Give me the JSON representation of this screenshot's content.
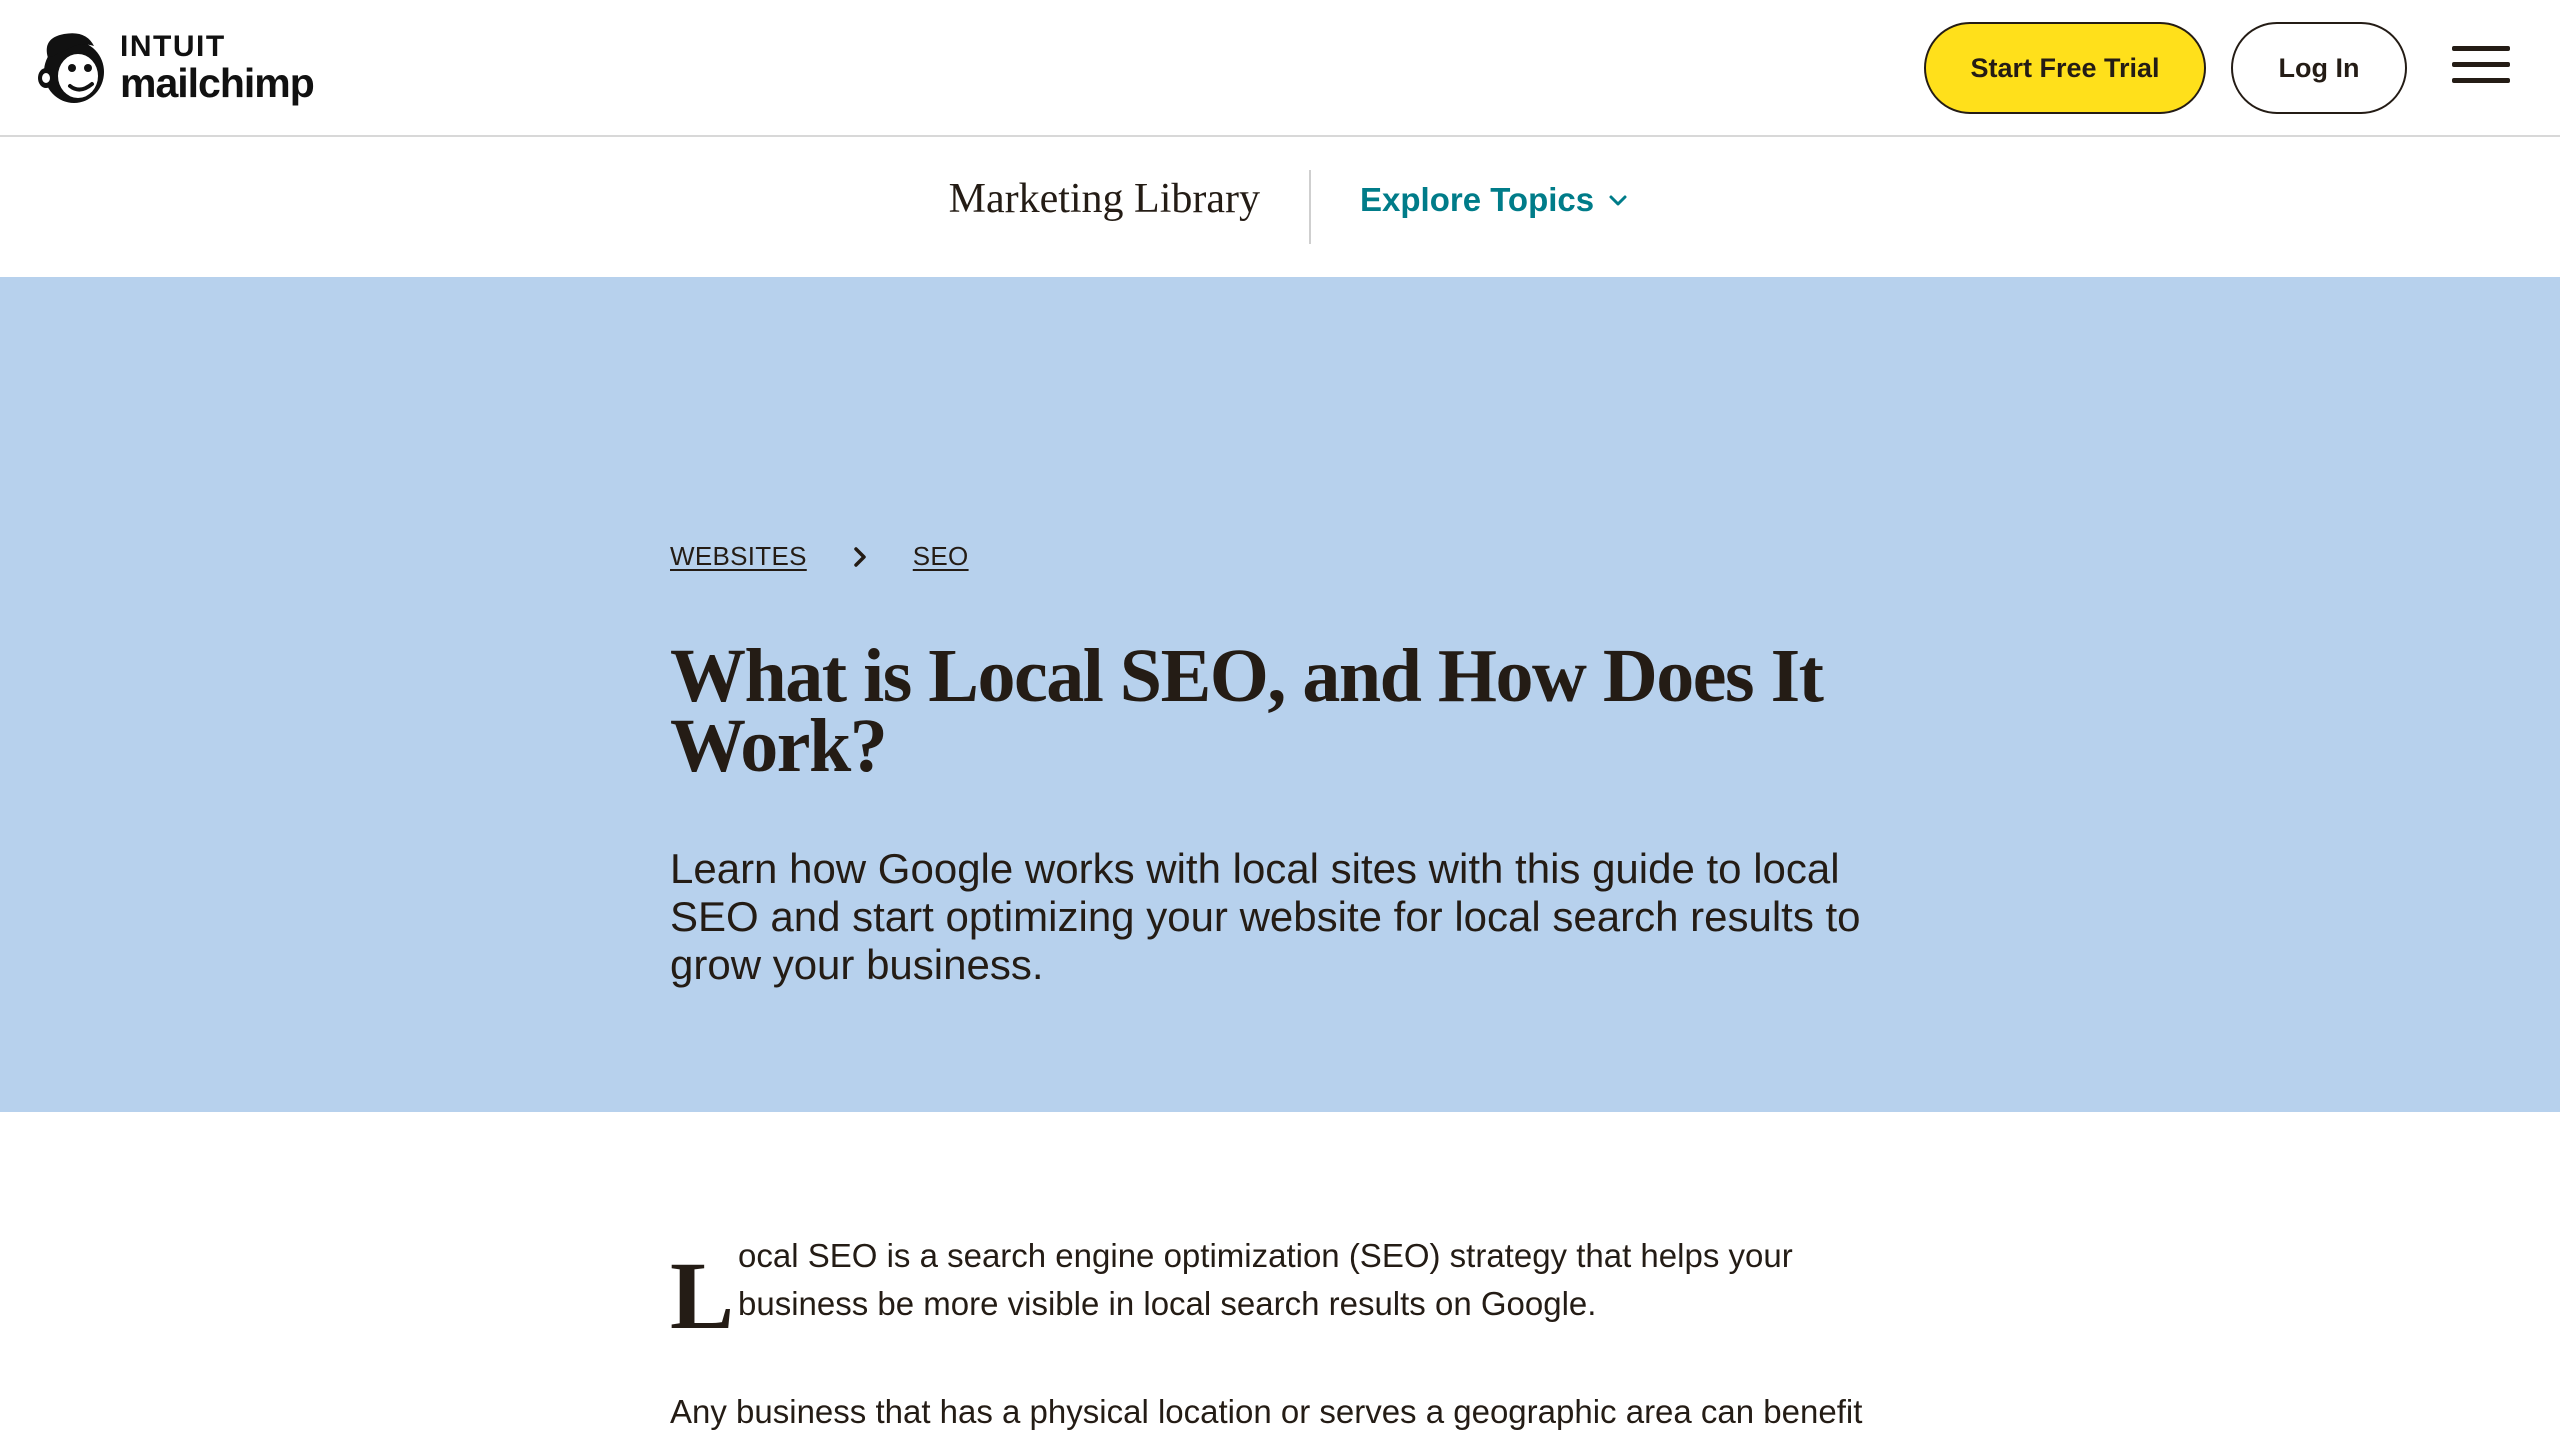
{
  "header": {
    "logo_top": "INTUIT",
    "logo_bottom": "mailchimp",
    "start_trial_label": "Start Free Trial",
    "login_label": "Log In"
  },
  "subnav": {
    "title": "Marketing Library",
    "explore_label": "Explore Topics"
  },
  "hero": {
    "background_color": "#b7d1ed",
    "breadcrumb": [
      "WEBSITES",
      "SEO"
    ],
    "title": "What is Local SEO, and How Does It Work?",
    "subtitle": "Learn how Google works with local sites with this guide to local SEO and start optimizing your website for local search results to grow your business."
  },
  "article": {
    "dropcap": "L",
    "intro": "ocal SEO is a search engine optimization (SEO) strategy that helps your business be more visible in local search results on Google.",
    "paragraph2": "Any business that has a physical location or serves a geographic area can benefit"
  },
  "colors": {
    "accent_yellow": "#ffe01b",
    "link_teal": "#007c89",
    "text_dark": "#241c15"
  },
  "icons": [
    "mailchimp-logo-icon",
    "hamburger-menu-icon",
    "chevron-down-icon",
    "chevron-right-icon"
  ]
}
